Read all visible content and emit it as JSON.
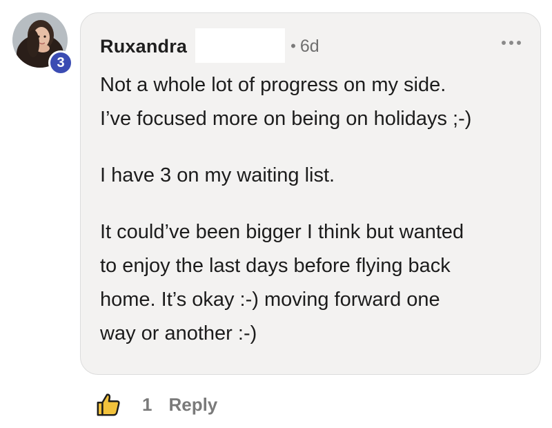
{
  "comment": {
    "author": "Ruxandra",
    "level": "3",
    "separator": "•",
    "timestamp": "6d",
    "paragraphs": [
      "Not a whole lot of progress on my side.\nI’ve focused more on being on holidays ;-)",
      "I have 3 on my waiting list.",
      "It could’ve been bigger I think but wanted\nto enjoy the last days before flying back\nhome. It’s okay :-) moving forward one\nway or another :-)"
    ],
    "likes": "1",
    "reply_label": "Reply"
  },
  "icons": {
    "more": "more-horizontal-icon",
    "like": "thumbs-up-icon"
  },
  "colors": {
    "bubble_background": "#f3f2f1",
    "badge": "#3b4cb3",
    "like_fill": "#f2c23c",
    "muted_text": "#7a7a7a"
  }
}
